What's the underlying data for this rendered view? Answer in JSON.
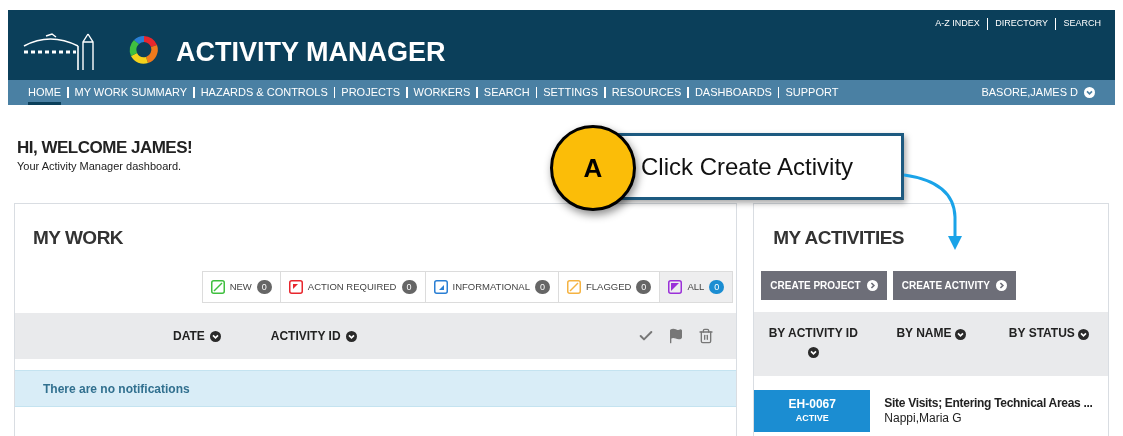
{
  "header": {
    "title": "ACTIVITY MANAGER",
    "utility_links": [
      "A-Z INDEX",
      "DIRECTORY",
      "SEARCH"
    ]
  },
  "nav": {
    "items": [
      {
        "label": "HOME",
        "selected": true
      },
      {
        "label": "MY WORK SUMMARY",
        "selected": false
      },
      {
        "label": "HAZARDS & CONTROLS",
        "selected": false
      },
      {
        "label": "PROJECTS",
        "selected": false
      },
      {
        "label": "WORKERS",
        "selected": false
      },
      {
        "label": "SEARCH",
        "selected": false
      },
      {
        "label": "SETTINGS",
        "selected": false
      },
      {
        "label": "RESOURCES",
        "selected": false
      },
      {
        "label": "DASHBOARDS",
        "selected": false
      },
      {
        "label": "SUPPORT",
        "selected": false
      }
    ],
    "user": "BASORE,JAMES D"
  },
  "welcome": {
    "title": "HI, WELCOME JAMES!",
    "subtitle": "Your Activity Manager dashboard."
  },
  "callout": {
    "badge": "A",
    "text": "Click Create Activity"
  },
  "my_work": {
    "title": "MY WORK",
    "filters": [
      {
        "label": "NEW",
        "count": "0",
        "color": "#3fbf3f",
        "selected": false
      },
      {
        "label": "ACTION REQUIRED",
        "count": "0",
        "color": "#e8262d",
        "selected": false
      },
      {
        "label": "INFORMATIONAL",
        "count": "0",
        "color": "#2a7fd4",
        "selected": false
      },
      {
        "label": "FLAGGED",
        "count": "0",
        "color": "#f5b342",
        "selected": false
      },
      {
        "label": "ALL",
        "count": "0",
        "color": "#9b30d9",
        "selected": true
      }
    ],
    "columns": [
      "DATE",
      "ACTIVITY ID"
    ],
    "empty_message": "There are no notifications"
  },
  "my_activities": {
    "title": "MY ACTIVITIES",
    "buttons": [
      "CREATE PROJECT",
      "CREATE ACTIVITY"
    ],
    "columns": [
      "BY ACTIVITY ID",
      "BY NAME",
      "BY STATUS"
    ],
    "rows": [
      {
        "id": "EH-0067",
        "status": "ACTIVE",
        "name": "Site Visits; Entering Technical Areas ...",
        "owner": "Nappi,Maria G"
      }
    ]
  }
}
